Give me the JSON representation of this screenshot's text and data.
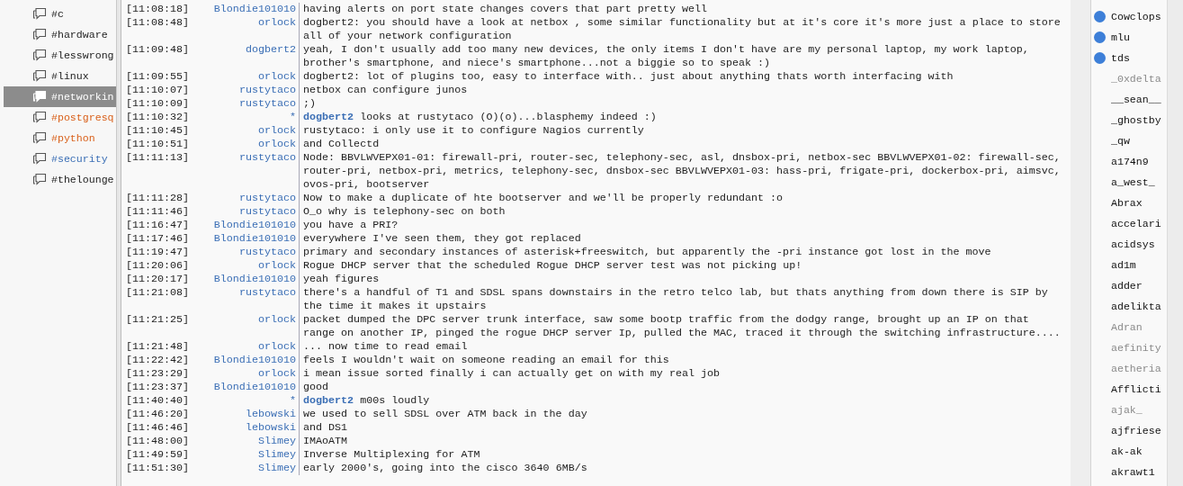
{
  "channels": [
    {
      "name": "#c",
      "selected": false,
      "highlight": false,
      "unread": false
    },
    {
      "name": "#hardware",
      "selected": false,
      "highlight": false,
      "unread": false
    },
    {
      "name": "#lesswrong",
      "selected": false,
      "highlight": false,
      "unread": false
    },
    {
      "name": "#linux",
      "selected": false,
      "highlight": false,
      "unread": false
    },
    {
      "name": "#networkin",
      "selected": true,
      "highlight": false,
      "unread": false
    },
    {
      "name": "#postgresq",
      "selected": false,
      "highlight": true
    },
    {
      "name": "#python",
      "selected": false,
      "highlight": true
    },
    {
      "name": "#security",
      "selected": false,
      "highlight": false,
      "unread": true
    },
    {
      "name": "#thelounge",
      "selected": false,
      "highlight": false,
      "unread": false
    }
  ],
  "messages": [
    {
      "kind": "message",
      "time": "[11:08:18]",
      "nick": "Blondie101010",
      "text": "having alerts on port state changes covers that part pretty well"
    },
    {
      "kind": "message",
      "time": "[11:08:48]",
      "nick": "orlock",
      "text": "dogbert2: you should have a look at netbox , some similar functionality but at it's core it's more just a place to store all of your network configuration"
    },
    {
      "kind": "message",
      "time": "[11:09:48]",
      "nick": "dogbert2",
      "text": "yeah, I don't usually add too many new devices, the only items I don't have are my personal laptop, my work laptop, brother's smartphone, and niece's smartphone...not a biggie so to speak :)"
    },
    {
      "kind": "message",
      "time": "[11:09:55]",
      "nick": "orlock",
      "text": "dogbert2: lot of plugins too, easy to interface with.. just about anything thats worth interfacing with"
    },
    {
      "kind": "message",
      "time": "[11:10:07]",
      "nick": "rustytaco",
      "text": "netbox can configure junos"
    },
    {
      "kind": "message",
      "time": "[11:10:09]",
      "nick": "rustytaco",
      "text": ";)"
    },
    {
      "kind": "action",
      "time": "[11:10:32]",
      "nick": "*",
      "actor": "dogbert2",
      "text": "looks at rustytaco (O)(o)...blasphemy indeed :)"
    },
    {
      "kind": "message",
      "time": "[11:10:45]",
      "nick": "orlock",
      "text": "rustytaco: i only use it to configure Nagios currently"
    },
    {
      "kind": "message",
      "time": "[11:10:51]",
      "nick": "orlock",
      "text": "and Collectd"
    },
    {
      "kind": "message",
      "time": "[11:11:13]",
      "nick": "rustytaco",
      "text": "Node: BBVLWVEPX01-01: firewall-pri, router-sec, telephony-sec, asl, dnsbox-pri, netbox-sec BBVLWVEPX01-02: firewall-sec, router-pri, netbox-pri, metrics, telephony-sec, dnsbox-sec BBVLWVEPX01-03: hass-pri, frigate-pri, dockerbox-pri, aimsvc, ovos-pri, bootserver"
    },
    {
      "kind": "message",
      "time": "[11:11:28]",
      "nick": "rustytaco",
      "text": "Now to make a duplicate of hte bootserver and we'll be properly redundant :o"
    },
    {
      "kind": "message",
      "time": "[11:11:46]",
      "nick": "rustytaco",
      "text": "O_o why is telephony-sec on both"
    },
    {
      "kind": "message",
      "time": "[11:16:47]",
      "nick": "Blondie101010",
      "text": "you have a PRI?"
    },
    {
      "kind": "message",
      "time": "[11:17:46]",
      "nick": "Blondie101010",
      "text": "everywhere I've seen them, they got replaced"
    },
    {
      "kind": "message",
      "time": "[11:19:47]",
      "nick": "rustytaco",
      "text": "primary and secondary instances of asterisk+freeswitch, but apparently the -pri instance got lost in the move"
    },
    {
      "kind": "message",
      "time": "[11:20:06]",
      "nick": "orlock",
      "text": "Rogue DHCP server that the scheduled Rogue DHCP server test was not picking up!"
    },
    {
      "kind": "message",
      "time": "[11:20:17]",
      "nick": "Blondie101010",
      "text": "yeah figures"
    },
    {
      "kind": "message",
      "time": "[11:21:08]",
      "nick": "rustytaco",
      "text": "there's a handful of T1 and SDSL spans downstairs in the retro telco lab, but thats anything from down there is SIP by the time it makes it upstairs"
    },
    {
      "kind": "message",
      "time": "[11:21:25]",
      "nick": "orlock",
      "text": "packet dumped the DPC server trunk interface, saw some bootp traffic from the dodgy range, brought up an IP on that range on another IP, pinged the rogue DHCP server Ip, pulled the MAC, traced it through the switching infrastructure...."
    },
    {
      "kind": "message",
      "time": "[11:21:48]",
      "nick": "orlock",
      "text": "... now time to read email"
    },
    {
      "kind": "message",
      "time": "[11:22:42]",
      "nick": "Blondie101010",
      "text": "feels I wouldn't wait on someone reading an email for this"
    },
    {
      "kind": "message",
      "time": "[11:23:29]",
      "nick": "orlock",
      "text": "i mean issue sorted finally i can actually get on with my real job"
    },
    {
      "kind": "message",
      "time": "[11:23:37]",
      "nick": "Blondie101010",
      "text": "good"
    },
    {
      "kind": "action",
      "time": "[11:40:40]",
      "nick": "*",
      "actor": "dogbert2",
      "text": "m00s loudly"
    },
    {
      "kind": "message",
      "time": "[11:46:20]",
      "nick": "lebowski",
      "text": "we used to sell SDSL over ATM back in the day"
    },
    {
      "kind": "message",
      "time": "[11:46:46]",
      "nick": "lebowski",
      "text": "and DS1"
    },
    {
      "kind": "message",
      "time": "[11:48:00]",
      "nick": "Slimey",
      "text": "IMAoATM"
    },
    {
      "kind": "message",
      "time": "[11:49:59]",
      "nick": "Slimey",
      "text": "Inverse Multiplexing for ATM"
    },
    {
      "kind": "message",
      "time": "[11:51:30]",
      "nick": "Slimey",
      "text": "early 2000's, going into the cisco 3640 6MB/s"
    }
  ],
  "users": [
    {
      "name": "Cowclops",
      "voiced": true,
      "away": false
    },
    {
      "name": "mlu",
      "voiced": true,
      "away": false
    },
    {
      "name": "tds",
      "voiced": true,
      "away": false
    },
    {
      "name": "_0xdelta",
      "voiced": false,
      "away": true
    },
    {
      "name": "__sean__",
      "voiced": false,
      "away": false
    },
    {
      "name": "_ghostby",
      "voiced": false,
      "away": false
    },
    {
      "name": "_qw",
      "voiced": false,
      "away": false
    },
    {
      "name": "a174n9",
      "voiced": false,
      "away": false
    },
    {
      "name": "a_west_",
      "voiced": false,
      "away": false
    },
    {
      "name": "Abrax",
      "voiced": false,
      "away": false
    },
    {
      "name": "accelari",
      "voiced": false,
      "away": false
    },
    {
      "name": "acidsys",
      "voiced": false,
      "away": false
    },
    {
      "name": "ad1m",
      "voiced": false,
      "away": false
    },
    {
      "name": "adder",
      "voiced": false,
      "away": false
    },
    {
      "name": "adelikta",
      "voiced": false,
      "away": false
    },
    {
      "name": "Adran",
      "voiced": false,
      "away": true
    },
    {
      "name": "aefinity",
      "voiced": false,
      "away": true
    },
    {
      "name": "aetheria",
      "voiced": false,
      "away": true
    },
    {
      "name": "Afflicti",
      "voiced": false,
      "away": false
    },
    {
      "name": "ajak_",
      "voiced": false,
      "away": true
    },
    {
      "name": "ajfriese",
      "voiced": false,
      "away": false
    },
    {
      "name": "ak-ak",
      "voiced": false,
      "away": false
    },
    {
      "name": "akrawt1",
      "voiced": false,
      "away": false
    }
  ]
}
